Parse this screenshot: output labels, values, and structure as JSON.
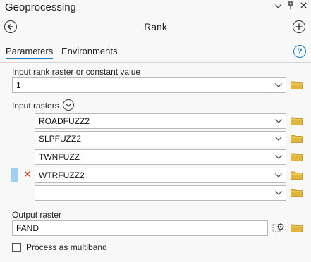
{
  "pane": {
    "title": "Geoprocessing",
    "header_icons": [
      "chevron-down-icon",
      "pin-icon",
      "close-icon"
    ]
  },
  "tool": {
    "title": "Rank",
    "back_icon": "back-arrow-icon",
    "add_icon": "add-icon"
  },
  "tabs": [
    {
      "label": "Parameters",
      "active": true
    },
    {
      "label": "Environments",
      "active": false
    }
  ],
  "help_icon_glyph": "?",
  "params": {
    "input_rank": {
      "label": "Input rank raster or constant value",
      "value": "1"
    },
    "input_rasters": {
      "label": "Input rasters",
      "items": [
        {
          "value": "ROADFUZZ2"
        },
        {
          "value": "SLPFUZZ2"
        },
        {
          "value": "TWNFUZZ"
        },
        {
          "value": "WTRFUZZ2",
          "selected": true
        },
        {
          "value": ""
        }
      ]
    },
    "output_raster": {
      "label": "Output raster",
      "value": "FAND"
    },
    "process_multiband": {
      "label": "Process as multiband",
      "checked": false
    }
  },
  "colors": {
    "accent": "#1a7fc1",
    "folder": "#e2b53b",
    "delete_x": "#c2532b",
    "selection_bar": "#9fd0f0"
  },
  "icons": {
    "folder": "folder-icon",
    "dropdown": "chevron-down-icon",
    "remove": "remove-x-icon",
    "expand": "expand-circle-icon",
    "environment": "environment-settings-icon"
  }
}
